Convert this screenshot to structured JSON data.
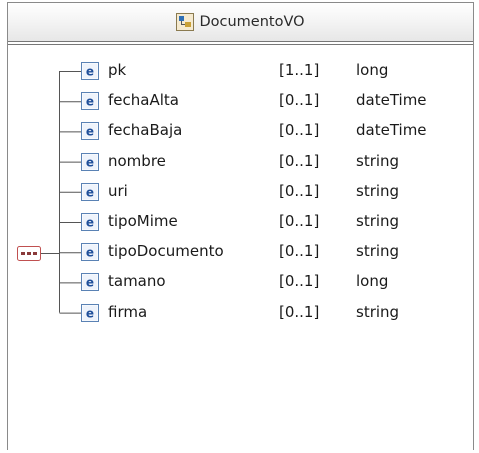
{
  "header": {
    "title": "DocumentoVO",
    "icon": "complex-type-icon"
  },
  "compositor": {
    "icon": "sequence-icon"
  },
  "elements": [
    {
      "name": "pk",
      "cardinality": "[1..1]",
      "type": "long"
    },
    {
      "name": "fechaAlta",
      "cardinality": "[0..1]",
      "type": "dateTime"
    },
    {
      "name": "fechaBaja",
      "cardinality": "[0..1]",
      "type": "dateTime"
    },
    {
      "name": "nombre",
      "cardinality": "[0..1]",
      "type": "string"
    },
    {
      "name": "uri",
      "cardinality": "[0..1]",
      "type": "string"
    },
    {
      "name": "tipoMime",
      "cardinality": "[0..1]",
      "type": "string"
    },
    {
      "name": "tipoDocumento",
      "cardinality": "[0..1]",
      "type": "string"
    },
    {
      "name": "tamano",
      "cardinality": "[0..1]",
      "type": "long"
    },
    {
      "name": "firma",
      "cardinality": "[0..1]",
      "type": "string"
    }
  ],
  "element_icon_letter": "e",
  "colors": {
    "border": "#8a8a8a",
    "connector": "#555555",
    "element_icon_bg": "#ffffff",
    "element_icon_border": "#5a82b4",
    "element_icon_text": "#1f4f9a",
    "sequence_icon_border": "#c05050"
  }
}
